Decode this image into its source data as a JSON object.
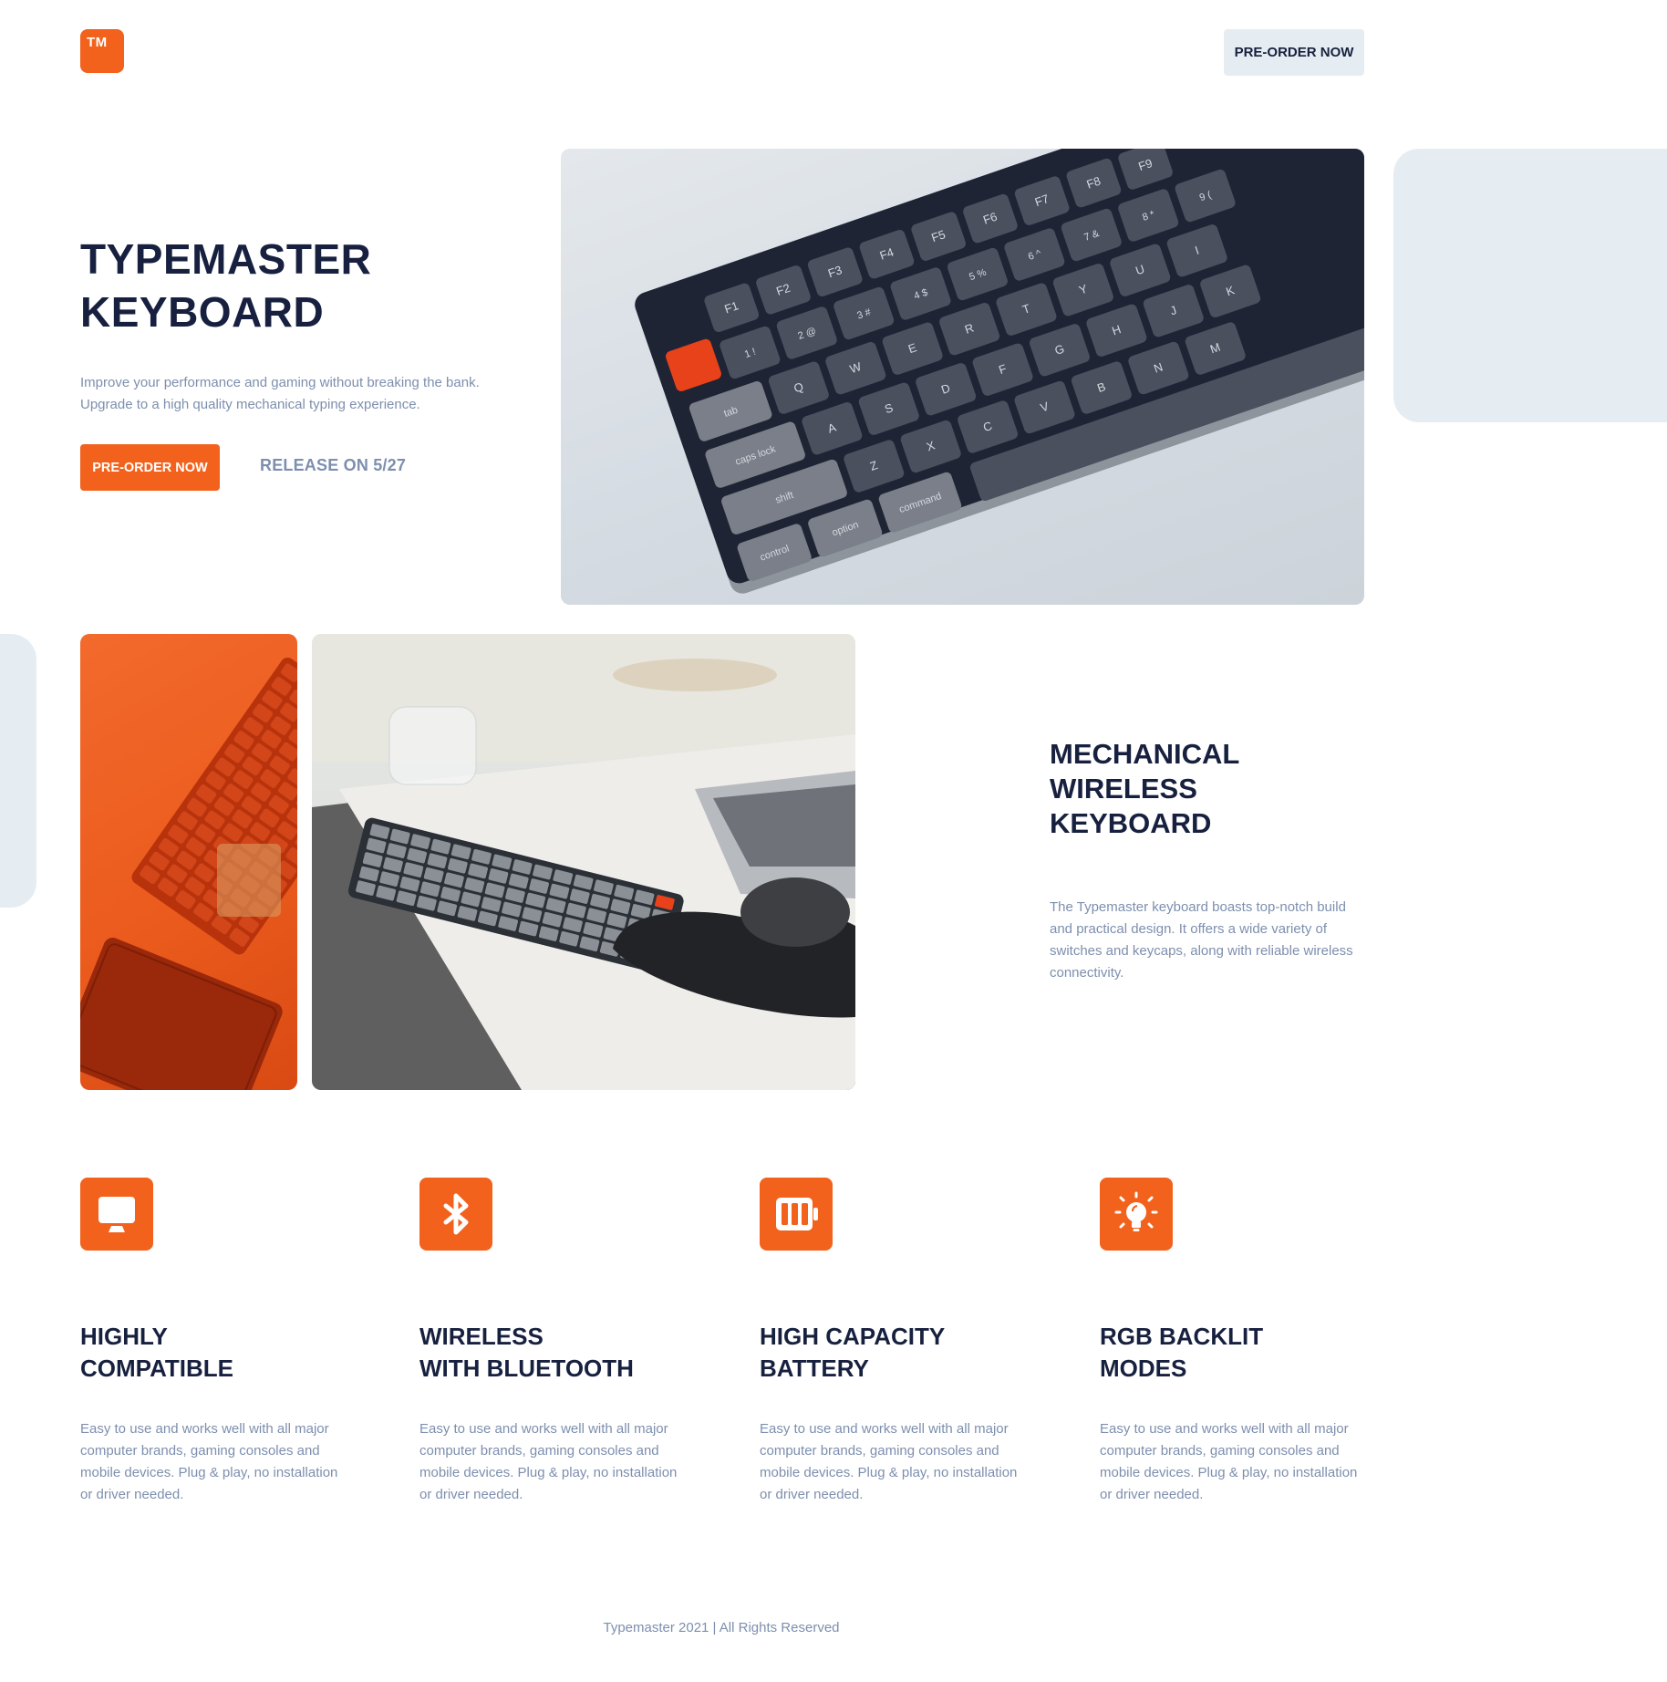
{
  "brand": {
    "logo_text": "TM",
    "accent": "#f2621c"
  },
  "nav": {
    "cta_label": "PRE-ORDER NOW"
  },
  "hero": {
    "title_line1": "TYPEMASTER",
    "title_line2": "KEYBOARD",
    "subtitle_line1": "Improve your performance and gaming without breaking the bank.",
    "subtitle_line2": "Upgrade to a high quality mechanical typing experience.",
    "cta_label": "PRE-ORDER NOW",
    "release_text": "RELEASE ON 5/27",
    "keys_row1": [
      "F1",
      "F2",
      "F3",
      "F4",
      "F5",
      "F6",
      "F7",
      "F8",
      "F9"
    ],
    "keys_row2": [
      "1 !",
      "2 @",
      "3 #",
      "4 $",
      "5 %",
      "6 ^",
      "7 &",
      "8 *",
      "9 ("
    ],
    "keys_row3": [
      "tab",
      "Q",
      "W",
      "E",
      "R",
      "T",
      "Y",
      "U",
      "I"
    ],
    "keys_row4": [
      "caps lock",
      "A",
      "S",
      "D",
      "F",
      "G",
      "H",
      "J",
      "K"
    ],
    "keys_row5": [
      "shift",
      "Z",
      "X",
      "C",
      "V",
      "B",
      "N",
      "M"
    ],
    "keys_row6": [
      "control",
      "option",
      "command"
    ]
  },
  "section": {
    "title_line1": "MECHANICAL",
    "title_line2": "WIRELESS",
    "title_line3": "KEYBOARD",
    "text": "The Typemaster keyboard boasts top-notch build and practical design. It offers a wide variety of switches and keycaps, along with reliable wireless connectivity."
  },
  "features": [
    {
      "icon": "monitor-icon",
      "title_line1": "HIGHLY",
      "title_line2": "COMPATIBLE",
      "text": "Easy to use and works well with all major computer brands, gaming consoles and mobile devices. Plug & play, no installation or driver needed."
    },
    {
      "icon": "bluetooth-icon",
      "title_line1": "WIRELESS",
      "title_line2": "WITH BLUETOOTH",
      "text": "Easy to use and works well with all major computer brands, gaming consoles and mobile devices. Plug & play, no installation or driver needed."
    },
    {
      "icon": "battery-icon",
      "title_line1": "HIGH CAPACITY",
      "title_line2": "BATTERY",
      "text": "Easy to use and works well with all major computer brands, gaming consoles and mobile devices. Plug & play, no installation or driver needed."
    },
    {
      "icon": "lightbulb-icon",
      "title_line1": "RGB BACKLIT",
      "title_line2": "MODES",
      "text": "Easy to use and works well with all major computer brands, gaming consoles and mobile devices. Plug & play, no installation or driver needed."
    }
  ],
  "footer": {
    "text": "Typemaster 2021 | All Rights Reserved"
  }
}
